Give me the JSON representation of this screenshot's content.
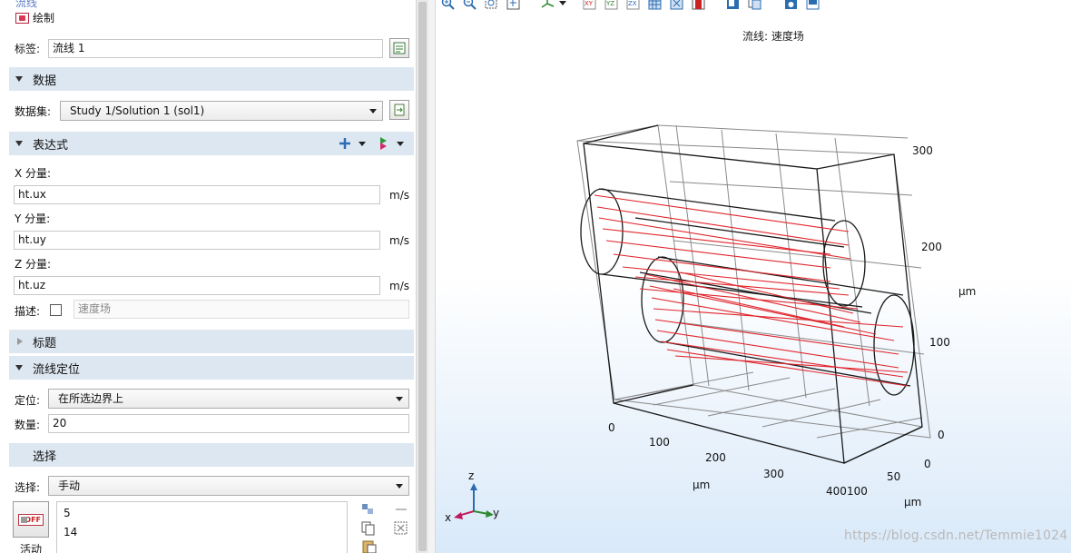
{
  "settings": {
    "truncated_title": "流线",
    "draw_label": "绘制",
    "label_caption": "标签:",
    "label_value": "流线 1",
    "sections": {
      "data": "数据",
      "expression": "表达式",
      "title": "标题",
      "positioning": "流线定位",
      "selection": "选择"
    },
    "dataset_caption": "数据集:",
    "dataset_value": "Study 1/Solution 1 (sol1)",
    "x_caption": "X 分量:",
    "x_value": "ht.ux",
    "y_caption": "Y 分量:",
    "y_value": "ht.uy",
    "z_caption": "Z 分量:",
    "z_value": "ht.uz",
    "unit": "m/s",
    "desc_caption": "描述:",
    "desc_checked": false,
    "desc_value": "速度场",
    "position_caption": "定位:",
    "position_value": "在所选边界上",
    "count_caption": "数量:",
    "count_value": "20",
    "selection_caption": "选择:",
    "selection_value": "手动",
    "active_label": "活动",
    "off_badge": "OFF",
    "selection_items": [
      "5",
      "14"
    ]
  },
  "graphics": {
    "plot_title": "流线: 速度场",
    "watermark": "https://blog.csdn.net/Temmie1024",
    "z_ticks": [
      "300",
      "200",
      "100",
      "0"
    ],
    "z_unit": "µm",
    "x_ticks": [
      "0",
      "100",
      "200",
      "300",
      "400"
    ],
    "x_unit": "µm",
    "y_ticks": [
      "100",
      "50",
      "0"
    ],
    "y_unit": "µm",
    "triad": {
      "x": "x",
      "y": "y",
      "z": "z"
    },
    "streamline_color": "#e0252b"
  }
}
